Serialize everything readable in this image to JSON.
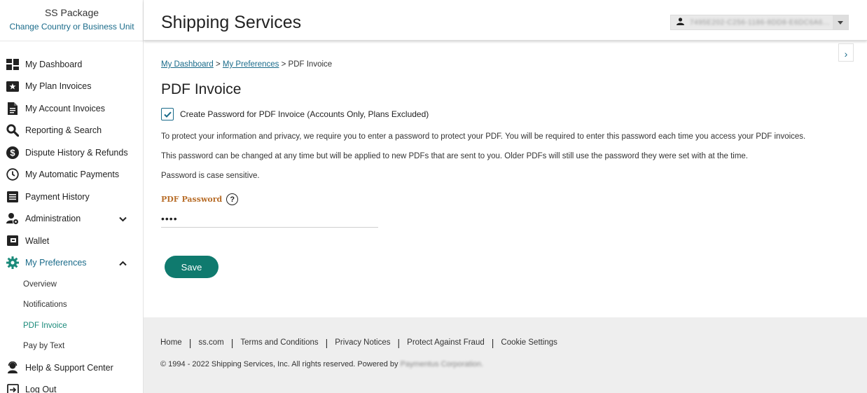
{
  "sidebar": {
    "brand_name": "SS Package",
    "change_link": "Change Country or Business Unit",
    "items": [
      {
        "label": "My Dashboard",
        "icon": "dashboard-icon"
      },
      {
        "label": "My Plan Invoices",
        "icon": "star-invoice-icon"
      },
      {
        "label": "My Account Invoices",
        "icon": "document-icon"
      },
      {
        "label": "Reporting & Search",
        "icon": "search-icon"
      },
      {
        "label": "Dispute History & Refunds",
        "icon": "dollar-icon"
      },
      {
        "label": "My Automatic Payments",
        "icon": "clock-icon"
      },
      {
        "label": "Payment History",
        "icon": "list-icon"
      },
      {
        "label": "Administration",
        "icon": "admin-icon"
      },
      {
        "label": "Wallet",
        "icon": "wallet-icon"
      },
      {
        "label": "My Preferences",
        "icon": "gear-icon"
      }
    ],
    "sub_items": [
      {
        "label": "Overview"
      },
      {
        "label": "Notifications"
      },
      {
        "label": "PDF Invoice"
      },
      {
        "label": "Pay by Text"
      }
    ],
    "bottom_items": [
      {
        "label": "Help & Support Center",
        "icon": "support-icon"
      },
      {
        "label": "Log Out",
        "icon": "logout-icon"
      }
    ]
  },
  "header": {
    "title": "Shipping Services",
    "account_id": "7495E202-C256-1186-8DD8-E6DC6A6..."
  },
  "breadcrumb": {
    "link1": "My Dashboard",
    "sep": " > ",
    "link2": "My Preferences",
    "current": "PDF Invoice"
  },
  "main": {
    "title": "PDF Invoice",
    "checkbox_label": "Create Password for PDF Invoice (Accounts Only, Plans Excluded)",
    "checkbox_checked": true,
    "para1": "To protect your information and privacy, we require you to enter a password to protect your PDF. You will be required to enter this password each time you access your PDF invoices.",
    "para2": "This password can be changed at any time but will be applied to new PDFs that are sent to you. Older PDFs will still use the password they were set with at the time.",
    "para3": "Password is case sensitive.",
    "password_label": "PDF Password",
    "password_value": "••••",
    "save_label": "Save"
  },
  "footer": {
    "links": [
      "Home",
      "ss.com",
      "Terms and Conditions",
      "Privacy Notices",
      "Protect Against Fraud",
      "Cookie Settings"
    ],
    "copyright": "© 1994 - 2022 Shipping Services, Inc. All rights reserved. Powered by ",
    "powered_by": "Paymentus Corporation."
  },
  "colors": {
    "accent": "#1a6b8a",
    "button": "#0f7a6e",
    "label": "#b86e2a"
  }
}
